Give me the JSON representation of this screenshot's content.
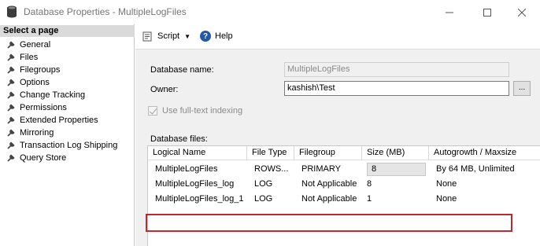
{
  "window": {
    "title": "Database Properties - MultipleLogFiles",
    "minimize_glyph": "—",
    "maximize_glyph": "☐",
    "close_glyph": "✕"
  },
  "sidebar": {
    "header": "Select a page",
    "items": [
      {
        "label": "General",
        "icon": "wrench-icon"
      },
      {
        "label": "Files",
        "icon": "wrench-icon"
      },
      {
        "label": "Filegroups",
        "icon": "wrench-icon"
      },
      {
        "label": "Options",
        "icon": "wrench-icon"
      },
      {
        "label": "Change Tracking",
        "icon": "wrench-icon"
      },
      {
        "label": "Permissions",
        "icon": "wrench-icon"
      },
      {
        "label": "Extended Properties",
        "icon": "wrench-icon"
      },
      {
        "label": "Mirroring",
        "icon": "wrench-icon"
      },
      {
        "label": "Transaction Log Shipping",
        "icon": "wrench-icon"
      },
      {
        "label": "Query Store",
        "icon": "wrench-icon"
      }
    ]
  },
  "toolbar": {
    "script_label": "Script",
    "help_label": "Help",
    "help_glyph": "?"
  },
  "form": {
    "database_name_label": "Database name:",
    "database_name_value": "MultipleLogFiles",
    "owner_label": "Owner:",
    "owner_value": "kashish\\Test",
    "browse_label": "...",
    "fulltext_label": "Use full-text indexing",
    "fulltext_checked": true,
    "database_files_label": "Database files:"
  },
  "grid": {
    "columns": [
      "Logical Name",
      "File Type",
      "Filegroup",
      "Size (MB)",
      "Autogrowth / Maxsize"
    ],
    "rows": [
      {
        "logical_name": "MultipleLogFiles",
        "file_type": "ROWS...",
        "filegroup": "PRIMARY",
        "size": "8",
        "autogrowth": "By 64 MB, Unlimited"
      },
      {
        "logical_name": "MultipleLogFiles_log",
        "file_type": "LOG",
        "filegroup": "Not Applicable",
        "size": "8",
        "autogrowth": "None"
      },
      {
        "logical_name": "MultipleLogFiles_log_1",
        "file_type": "LOG",
        "filegroup": "Not Applicable",
        "size": "1",
        "autogrowth": "None"
      }
    ],
    "highlighted_row": 2,
    "highlight_color": "#c0282f"
  }
}
